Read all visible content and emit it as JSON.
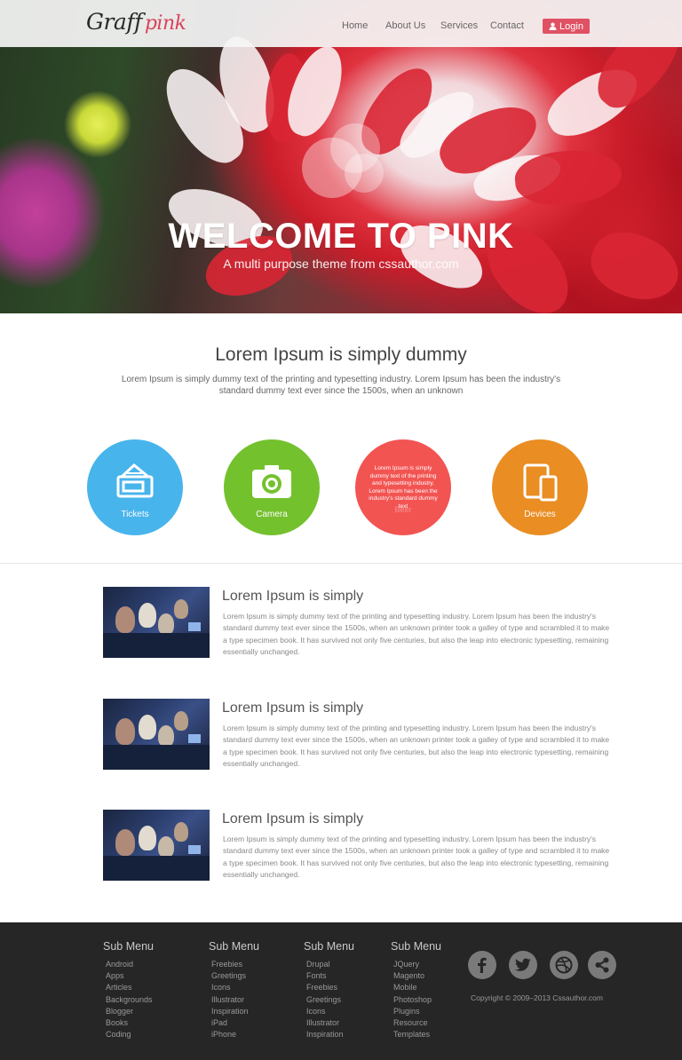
{
  "header": {
    "logo_part1": "Graff",
    "logo_part2": "pink",
    "nav": [
      "Home",
      "About Us",
      "Services",
      "Contact"
    ],
    "login_label": "Login"
  },
  "hero": {
    "title": "WELCOME TO PINK",
    "subtitle": "A multi purpose theme from cssauthor.com"
  },
  "intro": {
    "title": "Lorem Ipsum is simply dummy",
    "text": "Lorem Ipsum is simply dummy text of the printing and typesetting industry. Lorem Ipsum has been the industry's standard dummy text ever since the 1500s, when an unknown"
  },
  "features": [
    {
      "label": "Tickets",
      "color": "#48b4ec",
      "icon": "ticket-icon"
    },
    {
      "label": "Camera",
      "color": "#74c12e",
      "icon": "camera-icon"
    },
    {
      "label": "Beer",
      "color": "#f25452",
      "icon": "beer-icon",
      "hover_text": "Lorem Ipsum is simply dummy text of the printing and typesetting industry. Lorem Ipsum has been the industry's standard dummy text"
    },
    {
      "label": "Devices",
      "color": "#ea8d23",
      "icon": "devices-icon"
    }
  ],
  "articles": [
    {
      "title": "Lorem Ipsum is simply",
      "text": "Lorem Ipsum is simply dummy text of the printing and typesetting industry. Lorem Ipsum has been the industry's standard dummy text ever since the 1500s, when an unknown printer took a galley of type and scrambled it to make a type specimen book. It has survived not only five centuries, but also the leap into electronic typesetting, remaining essentially unchanged."
    },
    {
      "title": "Lorem Ipsum is simply",
      "text": "Lorem Ipsum is simply dummy text of the printing and typesetting industry. Lorem Ipsum has been the industry's standard dummy text ever since the 1500s, when an unknown printer took a galley of type and scrambled it to make a type specimen book. It has survived not only five centuries, but also the leap into electronic typesetting, remaining essentially unchanged."
    },
    {
      "title": "Lorem Ipsum is simply",
      "text": "Lorem Ipsum is simply dummy text of the printing and typesetting industry. Lorem Ipsum has been the industry's standard dummy text ever since the 1500s, when an unknown printer took a galley of type and scrambled it to make a type specimen book. It has survived not only five centuries, but also the leap into electronic typesetting, remaining essentially unchanged."
    }
  ],
  "footer": {
    "columns": [
      {
        "heading": "Sub Menu",
        "links": [
          "Android",
          "Apps",
          "Articles",
          "Backgrounds",
          "Blogger",
          "Books",
          "Coding"
        ]
      },
      {
        "heading": "Sub Menu",
        "links": [
          "Freebies",
          "Greetings",
          "Icons",
          "Illustrator",
          "Inspiration",
          "iPad",
          "iPhone"
        ]
      },
      {
        "heading": "Sub Menu",
        "links": [
          "Drupal",
          "Fonts",
          "Freebies",
          "Greetings",
          "Icons",
          "Illustrator",
          "Inspiration"
        ]
      },
      {
        "heading": "Sub Menu",
        "links": [
          "JQuery",
          "Magento",
          "Mobile",
          "Photoshop",
          "Plugins",
          "Resource",
          "Templates"
        ]
      }
    ],
    "social": [
      "facebook-icon",
      "twitter-icon",
      "dribbble-icon",
      "share-icon"
    ],
    "copyright": "Copyright © 2009–2013 Cssauthor.com"
  }
}
